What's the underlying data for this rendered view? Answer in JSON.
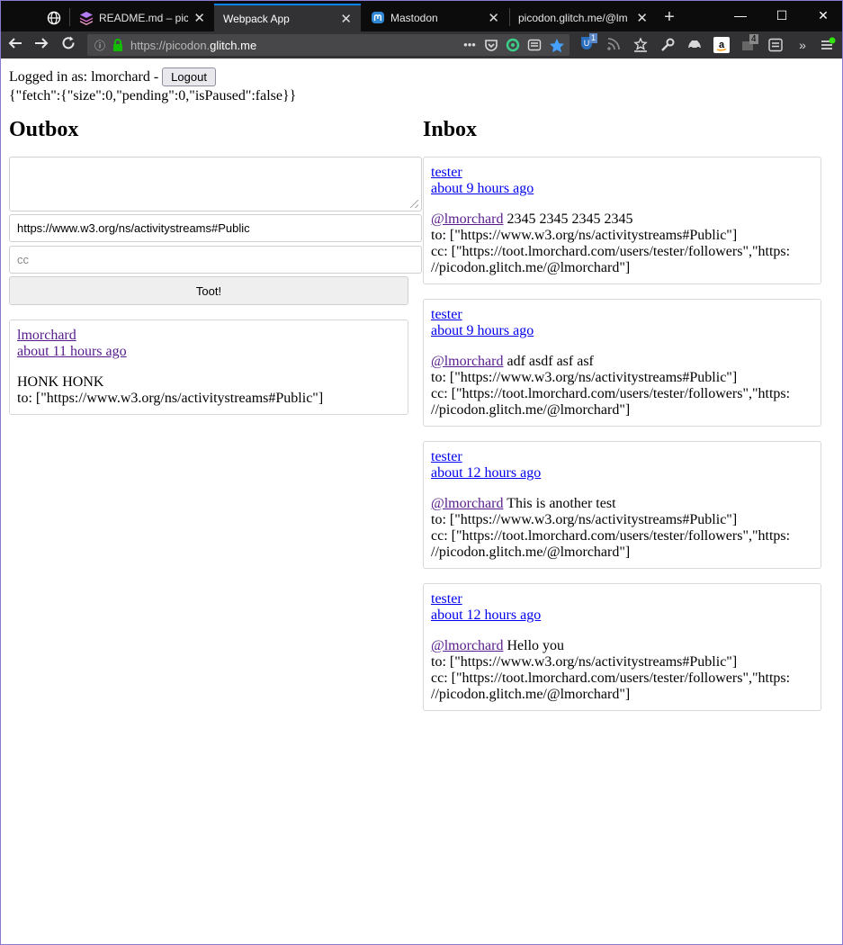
{
  "browser": {
    "tabs": [
      {
        "title": "README.md – pico",
        "active": false
      },
      {
        "title": "Webpack App",
        "active": true
      },
      {
        "title": "Mastodon",
        "active": false
      },
      {
        "title": "picodon.glitch.me/@lm",
        "active": false
      }
    ],
    "url_prefix": "https://picodon.",
    "url_host": "glitch.me",
    "toolbar_badges": {
      "ublock": "1",
      "tabs_count": "4"
    }
  },
  "page": {
    "login_label": "Logged in as: lmorchard -",
    "logout_label": "Logout",
    "status_json": "{\"fetch\":{\"size\":0,\"pending\":0,\"isPaused\":false}}",
    "outbox": {
      "title": "Outbox",
      "compose": {
        "content_value": "",
        "to_value": "https://www.w3.org/ns/activitystreams#Public",
        "cc_placeholder": "cc",
        "submit_label": "Toot!"
      },
      "items": [
        {
          "author": "lmorchard",
          "time": "about 11 hours ago",
          "content": "HONK HONK",
          "to": "to: [\"https://www.w3.org/ns/activitystreams#Public\"]"
        }
      ]
    },
    "inbox": {
      "title": "Inbox",
      "items": [
        {
          "author": "tester",
          "time": "about 9 hours ago",
          "mention": "@lmorchard",
          "text": " 2345 2345 2345 2345",
          "to": "to: [\"https://www.w3.org/ns/activitystreams#Public\"]",
          "cc1": "cc: [\"https://toot.lmorchard.com/users/tester/followers\",\"https:",
          "cc2": "//picodon.glitch.me/@lmorchard\"]"
        },
        {
          "author": "tester",
          "time": "about 9 hours ago",
          "mention": "@lmorchard",
          "text": " adf asdf asf asf",
          "to": "to: [\"https://www.w3.org/ns/activitystreams#Public\"]",
          "cc1": "cc: [\"https://toot.lmorchard.com/users/tester/followers\",\"https:",
          "cc2": "//picodon.glitch.me/@lmorchard\"]"
        },
        {
          "author": "tester",
          "time": "about 12 hours ago",
          "mention": "@lmorchard",
          "text": " This is another test",
          "to": "to: [\"https://www.w3.org/ns/activitystreams#Public\"]",
          "cc1": "cc: [\"https://toot.lmorchard.com/users/tester/followers\",\"https:",
          "cc2": "//picodon.glitch.me/@lmorchard\"]"
        },
        {
          "author": "tester",
          "time": "about 12 hours ago",
          "mention": "@lmorchard",
          "text": " Hello you",
          "to": "to: [\"https://www.w3.org/ns/activitystreams#Public\"]",
          "cc1": "cc: [\"https://toot.lmorchard.com/users/tester/followers\",\"https:",
          "cc2": "//picodon.glitch.me/@lmorchard\"]"
        }
      ]
    }
  }
}
